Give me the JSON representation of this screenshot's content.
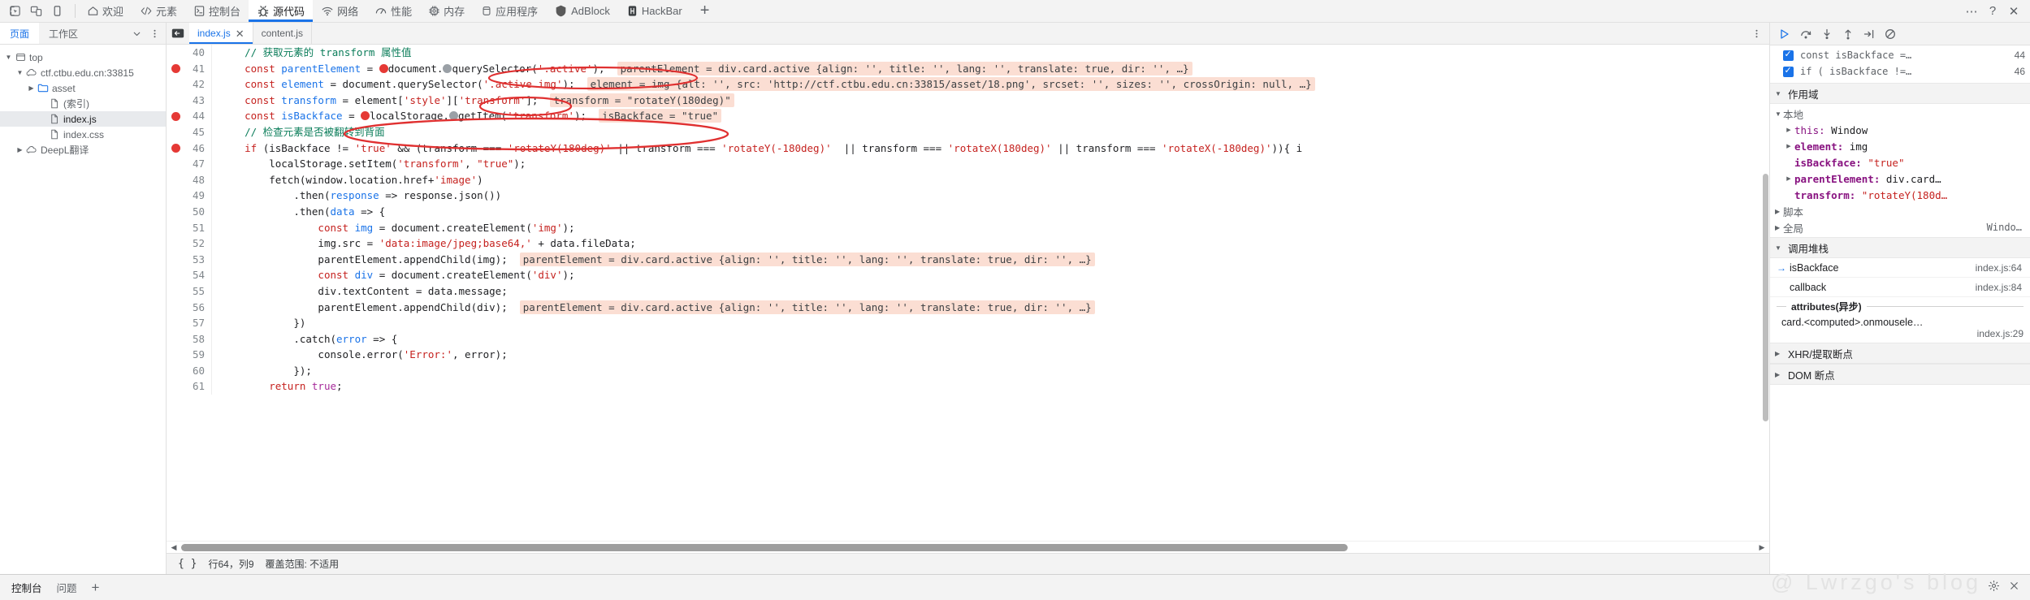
{
  "toolbar": {
    "left_icons": [
      {
        "name": "inspect-element-icon"
      },
      {
        "name": "device-toolbar-icon"
      },
      {
        "name": "dock-side-icon"
      }
    ],
    "tabs": [
      {
        "label": "欢迎",
        "icon": "home-icon",
        "active": false
      },
      {
        "label": "元素",
        "icon": "code-brackets-icon",
        "active": false
      },
      {
        "label": "控制台",
        "icon": "terminal-icon",
        "active": false
      },
      {
        "label": "源代码",
        "icon": "bug-icon",
        "active": true
      },
      {
        "label": "网络",
        "icon": "wifi-icon",
        "active": false
      },
      {
        "label": "性能",
        "icon": "gauge-icon",
        "active": false
      },
      {
        "label": "内存",
        "icon": "chip-icon",
        "active": false
      },
      {
        "label": "应用程序",
        "icon": "database-icon",
        "active": false
      },
      {
        "label": "AdBlock",
        "icon": "adblock-icon",
        "active": false
      },
      {
        "label": "HackBar",
        "icon": "hackbar-icon",
        "active": false
      }
    ],
    "add_tab_label": "+",
    "right_icons": [
      {
        "name": "more-options-icon",
        "glyph": "⋯"
      },
      {
        "name": "help-icon",
        "glyph": "?"
      },
      {
        "name": "close-devtools-icon",
        "glyph": "✕"
      }
    ]
  },
  "navigator": {
    "tabs": [
      {
        "label": "页面",
        "active": true
      },
      {
        "label": "工作区",
        "active": false
      }
    ],
    "more_tabs_icon": "chevron-down-icon",
    "more_options_icon": "more-vertical-icon",
    "tree": [
      {
        "label": "top",
        "icon": "frame-icon",
        "twisty": "▼",
        "depth": 0,
        "selected": false
      },
      {
        "label": "ctf.ctbu.edu.cn:33815",
        "icon": "cloud-icon",
        "twisty": "▼",
        "depth": 1,
        "selected": false
      },
      {
        "label": "asset",
        "icon": "folder-icon",
        "twisty": "▶",
        "depth": 2,
        "selected": false
      },
      {
        "label": "(索引)",
        "icon": "file-icon",
        "twisty": "",
        "depth": 3,
        "selected": false
      },
      {
        "label": "index.js",
        "icon": "file-icon",
        "twisty": "",
        "depth": 3,
        "selected": true
      },
      {
        "label": "index.css",
        "icon": "file-icon",
        "twisty": "",
        "depth": 3,
        "selected": false
      },
      {
        "label": "DeepL翻译",
        "icon": "cloud-icon",
        "twisty": "▶",
        "depth": 1,
        "selected": false
      }
    ]
  },
  "editor": {
    "panel_toggle_icon": "show-navigator-icon",
    "tabs": [
      {
        "label": "index.js",
        "active": true,
        "closable": true
      },
      {
        "label": "content.js",
        "active": false,
        "closable": false
      }
    ],
    "more_icon": "more-vertical-icon",
    "status": {
      "format_icon": "{ }",
      "position": "行64，列9",
      "coverage": "覆盖范围: 不适用"
    },
    "lines": [
      {
        "n": "40",
        "bp": false,
        "indent": 4,
        "tokens": [
          {
            "t": "// 获取元素的 transform 属性值",
            "c": "cmt"
          }
        ]
      },
      {
        "n": "41",
        "bp": true,
        "indent": 4,
        "tokens": [
          {
            "t": "const",
            "c": "kw"
          },
          {
            "t": " ",
            "c": "plain"
          },
          {
            "t": "parentElement",
            "c": "blue"
          },
          {
            "t": " = ",
            "c": "plain"
          },
          {
            "t": "●",
            "c": "dot-red"
          },
          {
            "t": "document.",
            "c": "plain"
          },
          {
            "t": "●",
            "c": "dot-gray"
          },
          {
            "t": "querySelector(",
            "c": "plain"
          },
          {
            "t": "'.active'",
            "c": "str"
          },
          {
            "t": ");",
            "c": "plain"
          }
        ],
        "hint": "parentElement = div.card.active {align: '', title: '', lang: '', translate: true, dir: '', …}"
      },
      {
        "n": "42",
        "bp": false,
        "indent": 4,
        "tokens": [
          {
            "t": "const",
            "c": "kw"
          },
          {
            "t": " ",
            "c": "plain"
          },
          {
            "t": "element",
            "c": "blue"
          },
          {
            "t": " = document.querySelector(",
            "c": "plain"
          },
          {
            "t": "'.active img'",
            "c": "str"
          },
          {
            "t": ");",
            "c": "plain"
          }
        ],
        "hint": "element = img {alt: '', src: 'http://ctf.ctbu.edu.cn:33815/asset/18.png', srcset: '', sizes: '', crossOrigin: null, …}"
      },
      {
        "n": "43",
        "bp": false,
        "indent": 4,
        "tokens": [
          {
            "t": "const",
            "c": "kw"
          },
          {
            "t": " ",
            "c": "plain"
          },
          {
            "t": "transform",
            "c": "blue"
          },
          {
            "t": " = element[",
            "c": "plain"
          },
          {
            "t": "'style'",
            "c": "str"
          },
          {
            "t": "][",
            "c": "plain"
          },
          {
            "t": "'transform'",
            "c": "str"
          },
          {
            "t": "];",
            "c": "plain"
          }
        ],
        "hint": "transform = \"rotateY(180deg)\""
      },
      {
        "n": "44",
        "bp": true,
        "indent": 4,
        "tokens": [
          {
            "t": "const",
            "c": "kw"
          },
          {
            "t": " ",
            "c": "plain"
          },
          {
            "t": "isBackface",
            "c": "blue"
          },
          {
            "t": " = ",
            "c": "plain"
          },
          {
            "t": "●",
            "c": "dot-red"
          },
          {
            "t": "localStorage.",
            "c": "plain"
          },
          {
            "t": "●",
            "c": "dot-gray"
          },
          {
            "t": "getItem(",
            "c": "plain"
          },
          {
            "t": "'transform'",
            "c": "str"
          },
          {
            "t": ");",
            "c": "plain"
          }
        ],
        "hint": "isBackface = \"true\""
      },
      {
        "n": "45",
        "bp": false,
        "indent": 4,
        "tokens": [
          {
            "t": "// 检查元素是否被翻转到背面",
            "c": "cmt"
          }
        ]
      },
      {
        "n": "46",
        "bp": true,
        "indent": 4,
        "tokens": [
          {
            "t": "if",
            "c": "kw"
          },
          {
            "t": " (",
            "c": "plain"
          },
          {
            "t": "isBackface",
            "c": "plain"
          },
          {
            "t": " != ",
            "c": "plain"
          },
          {
            "t": "'true'",
            "c": "str"
          },
          {
            "t": " && (transform === ",
            "c": "plain"
          },
          {
            "t": "'rotateY(180deg)'",
            "c": "str"
          },
          {
            "t": " || transform === ",
            "c": "plain"
          },
          {
            "t": "'rotateY(-180deg)'",
            "c": "str"
          },
          {
            "t": "  || transform === ",
            "c": "plain"
          },
          {
            "t": "'rotateX(180deg)'",
            "c": "str"
          },
          {
            "t": " || transform === ",
            "c": "plain"
          },
          {
            "t": "'rotateX(-180deg)'",
            "c": "str"
          },
          {
            "t": ")){",
            "c": "plain"
          },
          {
            "t": " i",
            "c": "plain"
          }
        ]
      },
      {
        "n": "47",
        "bp": false,
        "indent": 8,
        "tokens": [
          {
            "t": "localStorage.setItem(",
            "c": "plain"
          },
          {
            "t": "'transform'",
            "c": "str"
          },
          {
            "t": ", ",
            "c": "plain"
          },
          {
            "t": "\"true\"",
            "c": "str"
          },
          {
            "t": ");",
            "c": "plain"
          }
        ]
      },
      {
        "n": "48",
        "bp": false,
        "indent": 8,
        "tokens": [
          {
            "t": "fetch(window.location.href+",
            "c": "plain"
          },
          {
            "t": "'image'",
            "c": "str"
          },
          {
            "t": ")",
            "c": "plain"
          }
        ]
      },
      {
        "n": "49",
        "bp": false,
        "indent": 12,
        "tokens": [
          {
            "t": ".then(",
            "c": "plain"
          },
          {
            "t": "response",
            "c": "blue"
          },
          {
            "t": " => response.json())",
            "c": "plain"
          }
        ]
      },
      {
        "n": "50",
        "bp": false,
        "indent": 12,
        "tokens": [
          {
            "t": ".then(",
            "c": "plain"
          },
          {
            "t": "data",
            "c": "blue"
          },
          {
            "t": " => {",
            "c": "plain"
          }
        ]
      },
      {
        "n": "51",
        "bp": false,
        "indent": 16,
        "tokens": [
          {
            "t": "const",
            "c": "kw"
          },
          {
            "t": " ",
            "c": "plain"
          },
          {
            "t": "img",
            "c": "blue"
          },
          {
            "t": " = document.createElement(",
            "c": "plain"
          },
          {
            "t": "'img'",
            "c": "str"
          },
          {
            "t": ");",
            "c": "plain"
          }
        ]
      },
      {
        "n": "52",
        "bp": false,
        "indent": 16,
        "tokens": [
          {
            "t": "img.src = ",
            "c": "plain"
          },
          {
            "t": "'data:image/jpeg;base64,'",
            "c": "str"
          },
          {
            "t": " + data.fileData;",
            "c": "plain"
          }
        ]
      },
      {
        "n": "53",
        "bp": false,
        "indent": 16,
        "tokens": [
          {
            "t": "parentElement.appendChild(img);",
            "c": "plain"
          }
        ],
        "hint": "parentElement = div.card.active {align: '', title: '', lang: '', translate: true, dir: '', …}"
      },
      {
        "n": "54",
        "bp": false,
        "indent": 16,
        "tokens": [
          {
            "t": "const",
            "c": "kw"
          },
          {
            "t": " ",
            "c": "plain"
          },
          {
            "t": "div",
            "c": "blue"
          },
          {
            "t": " = document.createElement(",
            "c": "plain"
          },
          {
            "t": "'div'",
            "c": "str"
          },
          {
            "t": ");",
            "c": "plain"
          }
        ]
      },
      {
        "n": "55",
        "bp": false,
        "indent": 16,
        "tokens": [
          {
            "t": "div.textContent = data.message;",
            "c": "plain"
          }
        ]
      },
      {
        "n": "56",
        "bp": false,
        "indent": 16,
        "tokens": [
          {
            "t": "parentElement.appendChild(div);",
            "c": "plain"
          }
        ],
        "hint": "parentElement = div.card.active {align: '', title: '', lang: '', translate: true, dir: '', …}"
      },
      {
        "n": "57",
        "bp": false,
        "indent": 12,
        "tokens": [
          {
            "t": "})",
            "c": "plain"
          }
        ]
      },
      {
        "n": "58",
        "bp": false,
        "indent": 12,
        "tokens": [
          {
            "t": ".catch(",
            "c": "plain"
          },
          {
            "t": "error",
            "c": "blue"
          },
          {
            "t": " => {",
            "c": "plain"
          }
        ]
      },
      {
        "n": "59",
        "bp": false,
        "indent": 16,
        "tokens": [
          {
            "t": "console.error(",
            "c": "plain"
          },
          {
            "t": "'Error:'",
            "c": "str"
          },
          {
            "t": ", error);",
            "c": "plain"
          }
        ]
      },
      {
        "n": "60",
        "bp": false,
        "indent": 12,
        "tokens": [
          {
            "t": "});",
            "c": "plain"
          }
        ]
      },
      {
        "n": "61",
        "bp": false,
        "indent": 8,
        "tokens": [
          {
            "t": "return",
            "c": "kw"
          },
          {
            "t": " ",
            "c": "plain"
          },
          {
            "t": "true",
            "c": "kw2"
          },
          {
            "t": ";",
            "c": "plain"
          }
        ]
      }
    ]
  },
  "debugger": {
    "controls": [
      {
        "name": "resume-script-button",
        "glyph": "▶"
      },
      {
        "name": "step-over-button",
        "glyph": "↷"
      },
      {
        "name": "step-into-button",
        "glyph": "↓"
      },
      {
        "name": "step-out-button",
        "glyph": "↑"
      },
      {
        "name": "step-button",
        "glyph": "⇥"
      },
      {
        "name": "deactivate-breakpoints-button",
        "glyph": "⊘"
      }
    ],
    "breakpoints": [
      {
        "checked": true,
        "code": "const isBackface =…",
        "line": "44"
      },
      {
        "checked": true,
        "code": "if ( isBackface !=…",
        "line": "46"
      }
    ],
    "scope_header": "作用域",
    "scope_local_label": "本地",
    "scope_local": [
      {
        "twisty": "▶",
        "key": "this",
        "bold": false,
        "value": "Window",
        "value_style": "plain"
      },
      {
        "twisty": "▶",
        "key": "element",
        "bold": true,
        "value": "img",
        "value_style": "plain"
      },
      {
        "twisty": "",
        "key": "isBackface",
        "bold": true,
        "value": "\"true\"",
        "value_style": "str"
      },
      {
        "twisty": "▶",
        "key": "parentElement",
        "bold": true,
        "value": "div.card…",
        "value_style": "plain"
      },
      {
        "twisty": "",
        "key": "transform",
        "bold": true,
        "value": "\"rotateY(180d…",
        "value_style": "str"
      }
    ],
    "scope_script_label": "脚本",
    "scope_global_label": "全局",
    "scope_global_value": "Windo…",
    "callstack_header": "调用堆栈",
    "callstack": [
      {
        "selected": true,
        "fn": "isBackface",
        "loc": "index.js:64"
      },
      {
        "selected": false,
        "fn": "callback",
        "loc": "index.js:84"
      }
    ],
    "async_label": "attributes(异步)",
    "async_frame": {
      "fn": "card.<computed>.onmousele…",
      "loc": "index.js:29"
    },
    "xhr_header": "XHR/提取断点",
    "dom_header": "DOM 断点"
  },
  "drawer": {
    "tabs": [
      {
        "label": "控制台",
        "active": true
      },
      {
        "label": "问题",
        "active": false
      }
    ],
    "add_label": "+",
    "right_icons": [
      {
        "name": "settings-icon",
        "glyph": "⚙"
      },
      {
        "name": "close-drawer-icon",
        "glyph": "✕"
      }
    ]
  },
  "watermark": "@ Lwrzgo's blog",
  "colors": {
    "accent": "#1a73e8",
    "breakpoint": "#e53935",
    "hint_bg": "#fbded3",
    "toolbar_bg": "#f3f3f3",
    "annotation": "#e03030"
  }
}
